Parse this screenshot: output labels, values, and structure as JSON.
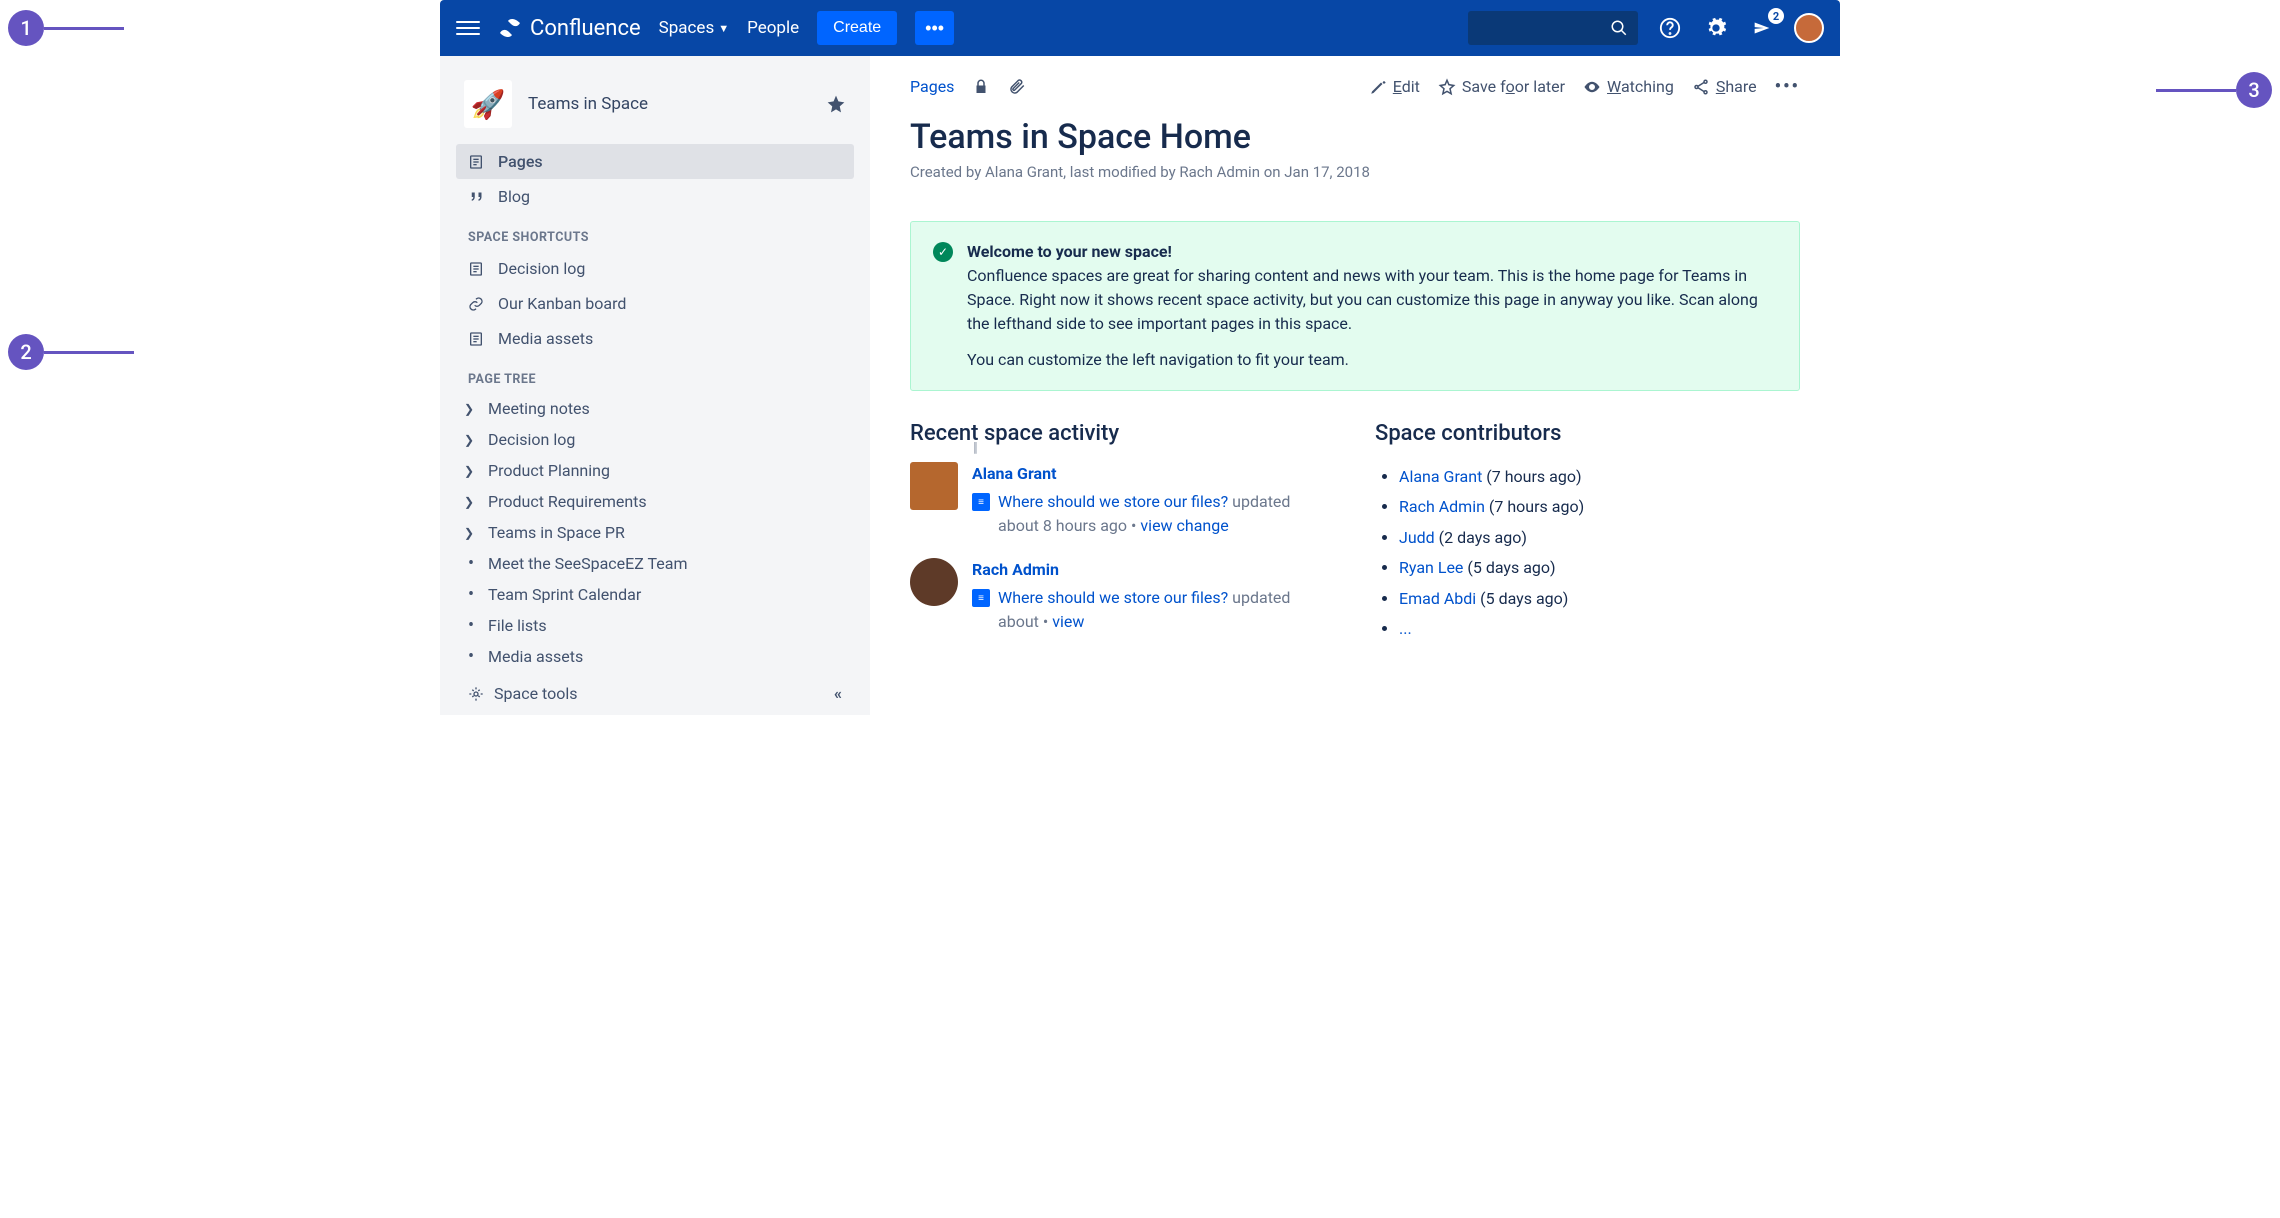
{
  "nav": {
    "brand": "Confluence",
    "spaces": "Spaces",
    "people": "People",
    "create": "Create",
    "notification_count": "2"
  },
  "sidebar": {
    "space_name": "Teams in Space",
    "pages": "Pages",
    "blog": "Blog",
    "shortcuts_title": "SPACE SHORTCUTS",
    "shortcuts": [
      {
        "label": "Decision log",
        "icon": "page"
      },
      {
        "label": "Our Kanban board",
        "icon": "link"
      },
      {
        "label": "Media assets",
        "icon": "page"
      }
    ],
    "tree_title": "PAGE TREE",
    "tree": [
      {
        "label": "Meeting notes",
        "expandable": true
      },
      {
        "label": "Decision log",
        "expandable": true
      },
      {
        "label": "Product Planning",
        "expandable": true
      },
      {
        "label": "Product Requirements",
        "expandable": true
      },
      {
        "label": "Teams in Space PR",
        "expandable": true
      },
      {
        "label": "Meet the SeeSpaceEZ Team",
        "expandable": false
      },
      {
        "label": "Team Sprint Calendar",
        "expandable": false
      },
      {
        "label": "File lists",
        "expandable": false
      },
      {
        "label": "Media assets",
        "expandable": false
      }
    ],
    "space_tools": "Space tools"
  },
  "toolbar": {
    "pages": "Pages",
    "edit_pre": "E",
    "edit_post": "dit",
    "save_pre": "Save f",
    "save_post": "or later",
    "watch_pre": "W",
    "watch_post": "atching",
    "share_pre": "S",
    "share_post": "hare"
  },
  "page": {
    "title": "Teams in Space Home",
    "meta": "Created by Alana Grant, last modified by Rach Admin on Jan 17, 2018"
  },
  "panel": {
    "heading": "Welcome to your new space!",
    "p1": "Confluence spaces are great for sharing content and news with your team. This is the home page for Teams in Space. Right now it shows recent space activity, but you can customize this page in anyway you like. Scan along the lefthand side to see important pages in this space.",
    "p2": "You can customize the left navigation to fit your team."
  },
  "activity": {
    "heading": "Recent space activity",
    "items": [
      {
        "name": "Alana Grant",
        "page": "Where should we store our files?",
        "meta": "updated about 8 hours ago",
        "action": "view change",
        "avatar_round": false,
        "avatar_color": "#b5672e"
      },
      {
        "name": "Rach Admin",
        "page": "Where should we store our files?",
        "meta": "updated about",
        "action": "view",
        "avatar_round": true,
        "avatar_color": "#5e3a28"
      }
    ]
  },
  "contributors": {
    "heading": "Space contributors",
    "list": [
      {
        "name": "Alana Grant",
        "when": "(7 hours ago)"
      },
      {
        "name": "Rach Admin",
        "when": "(7 hours ago)"
      },
      {
        "name": "Judd",
        "when": "(2 days ago)"
      },
      {
        "name": "Ryan Lee",
        "when": "(5 days ago)"
      },
      {
        "name": "Emad Abdi",
        "when": "(5 days ago)"
      },
      {
        "name": "...",
        "when": ""
      }
    ]
  },
  "callouts": {
    "c1": "1",
    "c2": "2",
    "c3": "3"
  }
}
